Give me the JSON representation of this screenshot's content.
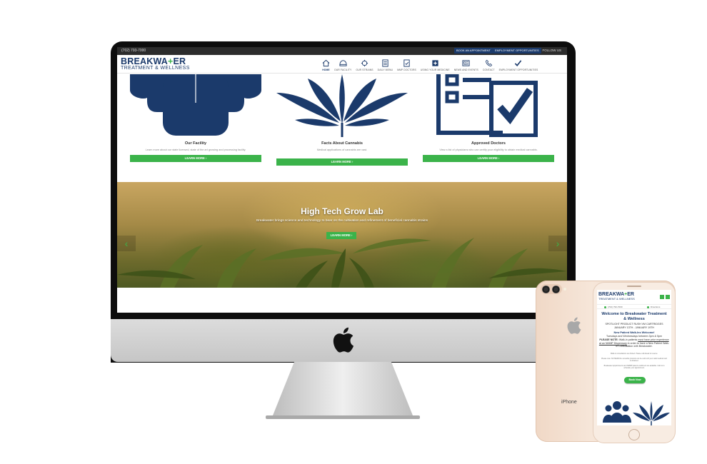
{
  "topbar": {
    "phone": "(702) 793-7000",
    "book_appointment": "BOOK AN APPOINTMENT",
    "employment": "EMPLOYMENT OPPORTUNITIES",
    "follow": "FOLLOW US"
  },
  "logo": {
    "main_left": "BREAKWA",
    "main_cross": "+",
    "main_right": "ER",
    "sub": "TREATMENT & WELLNESS"
  },
  "nav": {
    "items": [
      {
        "label": "HOME",
        "icon": "home-icon"
      },
      {
        "label": "OUR FACILITY",
        "icon": "facility-icon"
      },
      {
        "label": "OUR STRAINS",
        "icon": "strains-icon"
      },
      {
        "label": "DAILY MENU",
        "icon": "menu-icon"
      },
      {
        "label": "MMP DOCTORS",
        "icon": "doctors-icon"
      },
      {
        "label": "USING YOUR MEDICINE",
        "icon": "medicine-icon"
      },
      {
        "label": "NEWS AND EVENTS",
        "icon": "news-icon"
      },
      {
        "label": "CONTACT",
        "icon": "phone-icon"
      },
      {
        "label": "EMPLOYMENT OPPORTUNITIES",
        "icon": "checkmark-icon"
      }
    ]
  },
  "features": [
    {
      "title": "Our Facility",
      "desc": "Learn more about our state licensed, state of the art growing and processing facility.",
      "button": "LEARN MORE ›"
    },
    {
      "title": "Facts About Cannabis",
      "desc": "Medical applications of cannabis are vast.",
      "button": "LEARN MORE ›"
    },
    {
      "title": "Approved Doctors",
      "desc": "View a list of physicians who can certify your eligibility to obtain medical cannabis.",
      "button": "LEARN MORE ›"
    }
  ],
  "hero": {
    "title": "High Tech Grow Lab",
    "subtitle": "Breakwater brings science and technology to bear on the cultivation and refinement of beneficial cannabis strains",
    "button": "LEARN MORE ›",
    "prev": "‹",
    "next": "›"
  },
  "iphone": {
    "label": "iPhone",
    "phone": "(702) 793-7000",
    "directions": "Directions",
    "title": "Welcome to Breakwater Treatment & Wellness",
    "spotlight": "SPOTLIGHT PRODUCT RUSH VM CARTRIDGES",
    "dates": "JANUARY 13TH - JANUARY 19TH",
    "walkins": "New Patient Walk-Ins Welcome!",
    "hours": "Tuesdays and Wednesdays between 3pm & 5pm",
    "note_label": "PLEASE NOTE:",
    "note_text": " Walk-in patients ",
    "note_underline": "must have prior experience at an NMMP Dispensary",
    "note_end": " in order to have a New Patient Walk-In Consultation with Breakwater.",
    "small1": "Walk-in consultations are limited. Please call ahead to reserve.",
    "small2": "Please note: NO MEDICAL cannabis products can be sold until your valid medical card is obtained.",
    "small3": "Breakwater appointments and NMMP patient enrollment are available. Call us to schedule your appointment.",
    "book_button": "Book Now"
  },
  "colors": {
    "brand_navy": "#1b3a6b",
    "brand_green": "#3bb34a"
  }
}
